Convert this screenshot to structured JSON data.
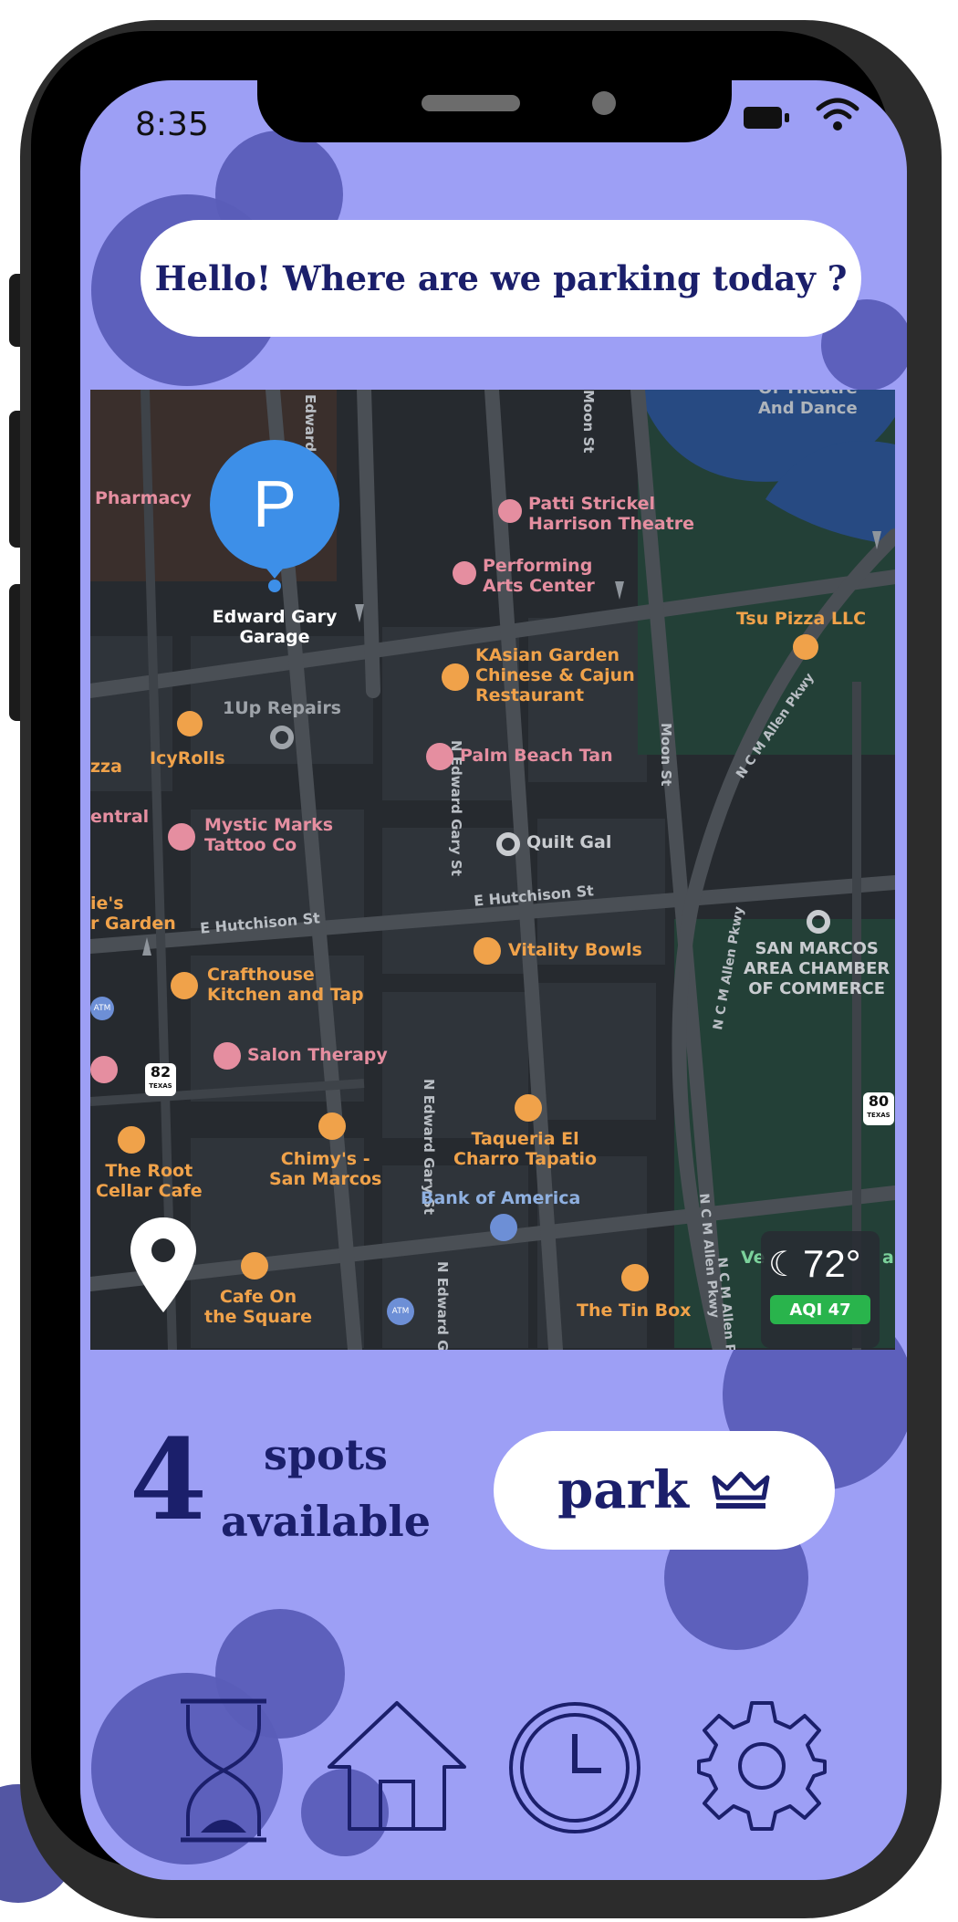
{
  "status_bar": {
    "time": "8:35"
  },
  "greeting": {
    "text": "Hello! Where are we parking today ?"
  },
  "map": {
    "streets": [
      "Edward Gary St",
      "N Edward Gary St",
      "N Edward Gary St",
      "N Edward Ga",
      "Moon St",
      "Moon St",
      "E Hutchison St",
      "E Hutchison St",
      "N C M Allen Pkwy",
      "N C M Allen Pkwy",
      "N C M Allen Pkwy",
      "N C M Allen Pkwy"
    ],
    "pin": {
      "letter": "P",
      "label_line1": "Edward Gary",
      "label_line2": "Garage"
    },
    "places": [
      {
        "name": "Pharmacy",
        "color": "#e58ea0"
      },
      {
        "name": "Patti Strickel",
        "color": "#e58ea0"
      },
      {
        "name": "Harrison Theatre",
        "color": "#e58ea0"
      },
      {
        "name": "Performing",
        "color": "#e58ea0"
      },
      {
        "name": "Arts Center",
        "color": "#e58ea0"
      },
      {
        "name": "Of Theatre",
        "color": "#aeb4bb"
      },
      {
        "name": "And Dance",
        "color": "#aeb4bb"
      },
      {
        "name": "Tsu Pizza LLC",
        "color": "#f0a24a"
      },
      {
        "name": "KAsian Garden",
        "color": "#f0a24a"
      },
      {
        "name": "Chinese & Cajun",
        "color": "#f0a24a"
      },
      {
        "name": "Restaurant",
        "color": "#f0a24a"
      },
      {
        "name": "1Up Repairs",
        "color": "#9ea3a9"
      },
      {
        "name": "IcyRolls",
        "color": "#f0a24a"
      },
      {
        "name": "zza",
        "color": "#f0a24a"
      },
      {
        "name": "Palm Beach Tan",
        "color": "#e58ea0"
      },
      {
        "name": "entral",
        "color": "#e58ea0"
      },
      {
        "name": "Mystic Marks",
        "color": "#e58ea0"
      },
      {
        "name": "Tattoo Co",
        "color": "#e58ea0"
      },
      {
        "name": "Quilt Gal",
        "color": "#c9ccd0"
      },
      {
        "name": "ie's",
        "color": "#f0a24a"
      },
      {
        "name": "r Garden",
        "color": "#f0a24a"
      },
      {
        "name": "Vitality Bowls",
        "color": "#f0a24a"
      },
      {
        "name": "SAN MARCOS",
        "color": "#c9ccd0"
      },
      {
        "name": "AREA CHAMBER",
        "color": "#c9ccd0"
      },
      {
        "name": "OF COMMERCE",
        "color": "#c9ccd0"
      },
      {
        "name": "Crafthouse",
        "color": "#f0a24a"
      },
      {
        "name": "Kitchen and Tap",
        "color": "#f0a24a"
      },
      {
        "name": "Salon Therapy",
        "color": "#e58ea0"
      },
      {
        "name": "The Root",
        "color": "#f0a24a"
      },
      {
        "name": "Cellar Cafe",
        "color": "#f0a24a"
      },
      {
        "name": "Chimy's -",
        "color": "#f0a24a"
      },
      {
        "name": "San Marcos",
        "color": "#f0a24a"
      },
      {
        "name": "Taqueria El",
        "color": "#f0a24a"
      },
      {
        "name": "Charro Tapatio",
        "color": "#f0a24a"
      },
      {
        "name": "Bank of America",
        "color": "#8fb0e0"
      },
      {
        "name": "Cafe On",
        "color": "#f0a24a"
      },
      {
        "name": "the Square",
        "color": "#f0a24a"
      },
      {
        "name": "The Tin Box",
        "color": "#f0a24a"
      },
      {
        "name": "Ve",
        "color": "#7bd19b"
      },
      {
        "name": "a",
        "color": "#7bd19b"
      }
    ],
    "badges": {
      "route_82": "82",
      "route_82_sub": "TEXAS",
      "route_80": "80",
      "route_80_sub": "TEXAS",
      "atm": "ATM"
    },
    "weather": {
      "temp": "72°",
      "aqi": "AQI 47"
    }
  },
  "availability": {
    "count": "4",
    "line1": "spots",
    "line2": "available"
  },
  "park_button": {
    "label": "park",
    "icon": "crown-icon"
  },
  "nav": [
    {
      "name": "history",
      "icon": "hourglass-icon"
    },
    {
      "name": "home",
      "icon": "home-icon"
    },
    {
      "name": "timer",
      "icon": "clock-icon"
    },
    {
      "name": "settings",
      "icon": "gear-icon"
    }
  ],
  "colors": {
    "screen": "#9d9ff5",
    "accent": "#1b1f6b",
    "bubble": "#5a5db8",
    "map_bg": "#262a2f",
    "pin": "#3d8fe8"
  }
}
